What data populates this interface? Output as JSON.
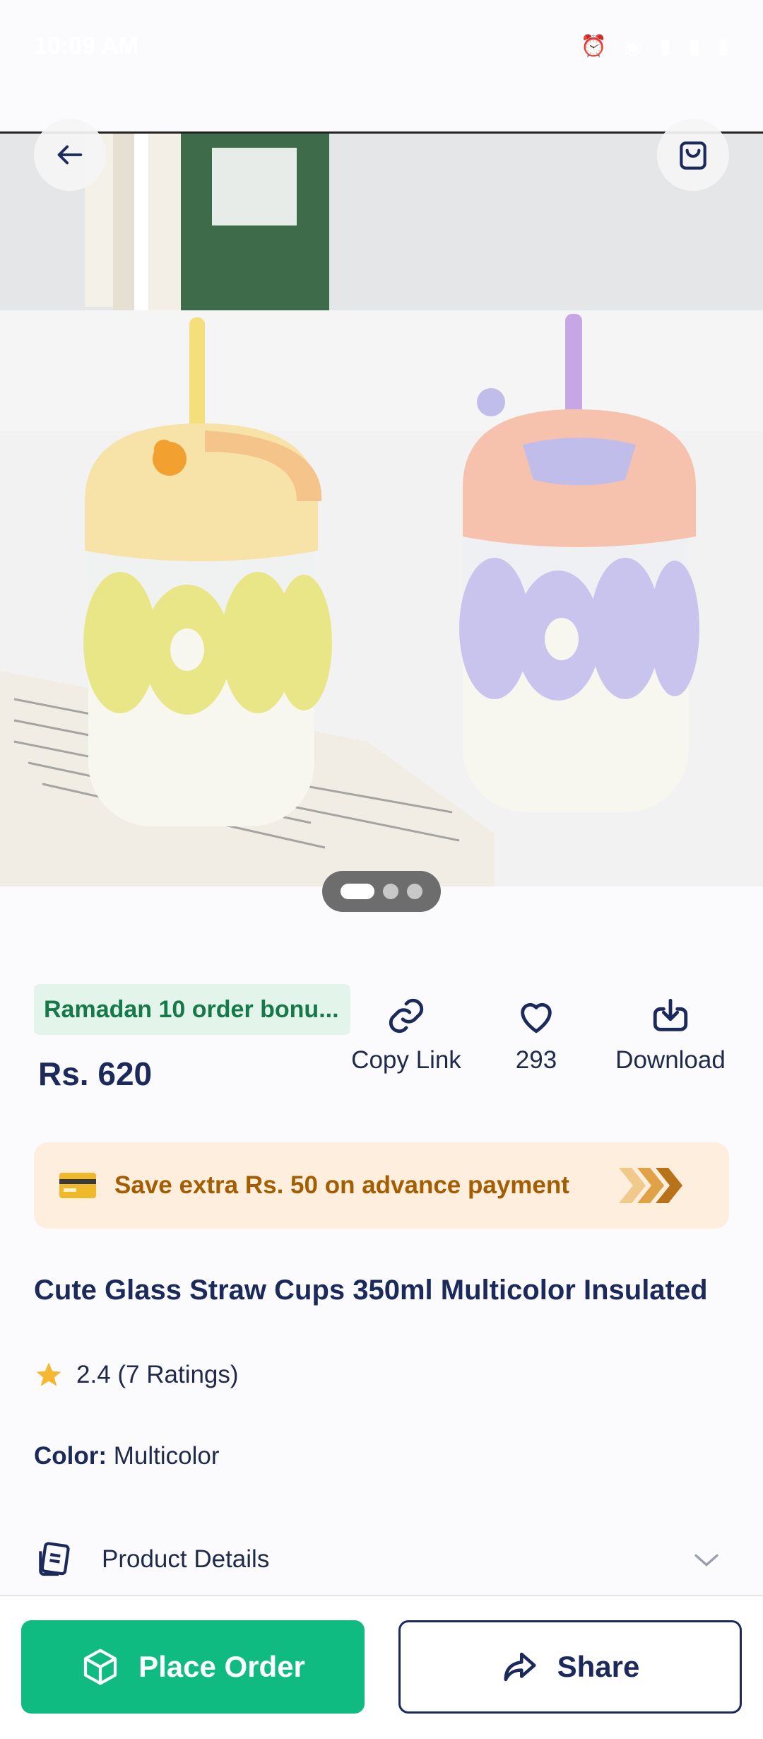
{
  "status_bar": {
    "time": "10:09 AM",
    "icons": "⏰ ◉ ▮ ▮ ▮"
  },
  "header": {
    "back_icon": "arrow-left-icon",
    "cart_icon": "shopping-bag-icon"
  },
  "gallery": {
    "images": 3,
    "active_index": 0
  },
  "promo": {
    "badge": "Ramadan 10 order bonu..."
  },
  "product": {
    "price": "Rs. 620",
    "title": "Cute Glass Straw Cups 350ml Multicolor Insulated",
    "rating_text": "2.4 (7 Ratings)",
    "color_label": "Color:",
    "color_value": "Multicolor"
  },
  "actions": {
    "copy_link": "Copy Link",
    "likes": "293",
    "download": "Download"
  },
  "advance_payment": {
    "text": "Save extra Rs. 50 on advance payment"
  },
  "details": {
    "label": "Product Details"
  },
  "bottom": {
    "order_label": "Place Order",
    "share_label": "Share"
  },
  "colors": {
    "primary": "#10bb82",
    "navy": "#1b2a5a",
    "promo_bg": "#e3f5ea",
    "advance_bg": "#fdeede",
    "star": "#f7b733"
  }
}
